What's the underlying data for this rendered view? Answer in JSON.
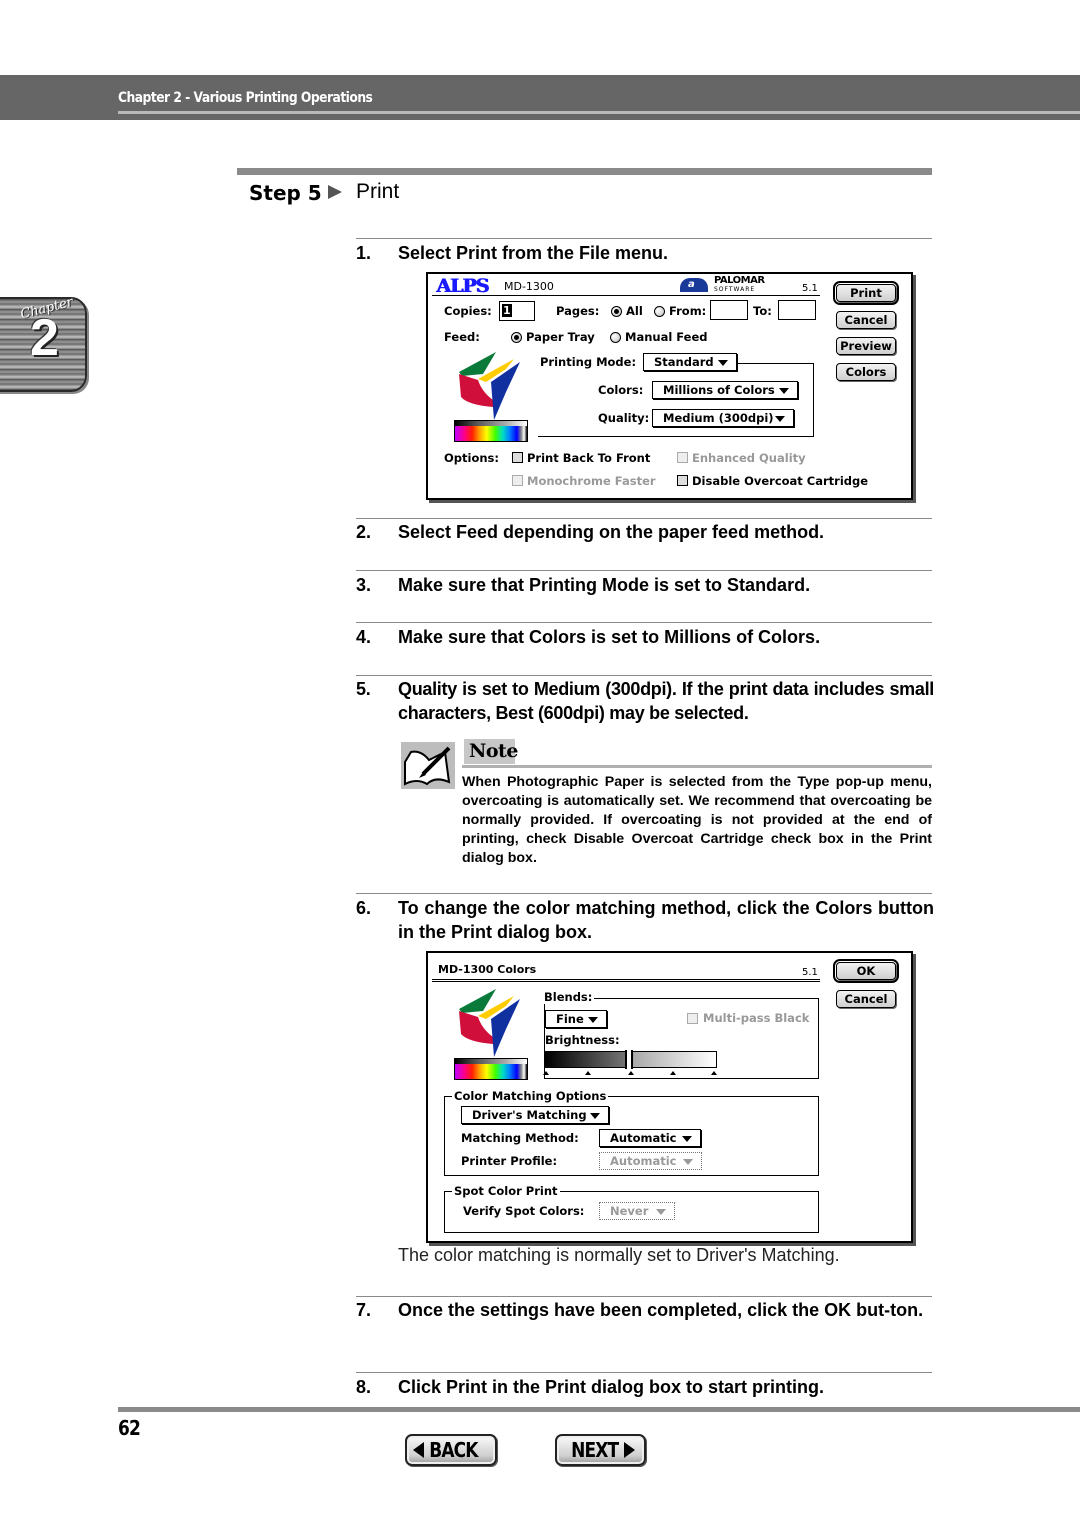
{
  "header": {
    "title": "Chapter 2 - Various Printing Operations"
  },
  "chapter_tab": {
    "word": "Chapter",
    "number": "2"
  },
  "step": {
    "label": "Step 5",
    "title": "Print"
  },
  "items": [
    {
      "num": "1.",
      "text": "Select Print from the File menu."
    },
    {
      "num": "2.",
      "text": "Select Feed depending on the paper feed method."
    },
    {
      "num": "3.",
      "text": "Make sure that Printing Mode is set to Standard."
    },
    {
      "num": "4.",
      "text": "Make sure that Colors is set to Millions of Colors."
    },
    {
      "num": "5.",
      "text": "Quality is set to Medium (300dpi). If the print data includes small characters, Best (600dpi) may be selected."
    },
    {
      "num": "6.",
      "text": "To change the color matching method, click the Colors button in the Print dialog box."
    },
    {
      "num": "7.",
      "text": "Once the settings have been completed, click the OK but-ton."
    },
    {
      "num": "8.",
      "text": "Click Print in the Print dialog box to start printing."
    }
  ],
  "note": {
    "title": "Note",
    "text": "When Photographic Paper is selected from the Type pop-up menu, overcoating is automatically set. We recommend that overcoating be normally provided. If overcoating is not provided at the end of printing, check Disable Overcoat Cartridge check box in the Print dialog box."
  },
  "caption": "The color matching is normally set to Driver's Matching.",
  "print_dialog": {
    "brand": "ALPS",
    "model": "MD-1300",
    "vendor_line1": "PALOMAR",
    "vendor_line2": "SOFTWARE",
    "version": "5.1",
    "copies_label": "Copies:",
    "copies_value": "1",
    "pages_label": "Pages:",
    "pages_all": "All",
    "pages_from": "From:",
    "pages_to": "To:",
    "from_value": "",
    "to_value": "",
    "feed_label": "Feed:",
    "feed_paper_tray": "Paper Tray",
    "feed_manual": "Manual Feed",
    "printing_mode_label": "Printing Mode:",
    "printing_mode_value": "Standard",
    "colors_label": "Colors:",
    "colors_value": "Millions of Colors",
    "quality_label": "Quality:",
    "quality_value": "Medium (300dpi)",
    "options_label": "Options:",
    "opt_back_to_front": "Print Back To Front",
    "opt_enhanced_quality": "Enhanced Quality",
    "opt_monochrome_faster": "Monochrome Faster",
    "opt_disable_overcoat": "Disable Overcoat Cartridge",
    "buttons": {
      "print": "Print",
      "cancel": "Cancel",
      "preview": "Preview",
      "colors": "Colors"
    }
  },
  "colors_dialog": {
    "title": "MD-1300 Colors",
    "version": "5.1",
    "blends_label": "Blends:",
    "blends_value": "Fine",
    "multipass_black": "Multi-pass Black",
    "brightness_label": "Brightness:",
    "brightness_level": 0.5,
    "color_matching_group": "Color Matching Options",
    "matching_value": "Driver's Matching",
    "matching_method_label": "Matching Method:",
    "matching_method_value": "Automatic",
    "printer_profile_label": "Printer Profile:",
    "printer_profile_value": "Automatic",
    "spot_color_group": "Spot Color Print",
    "verify_spot_label": "Verify Spot Colors:",
    "verify_spot_value": "Never",
    "buttons": {
      "ok": "OK",
      "cancel": "Cancel"
    }
  },
  "footer": {
    "page_number": "62",
    "back_label": "BACK",
    "next_label": "NEXT"
  }
}
